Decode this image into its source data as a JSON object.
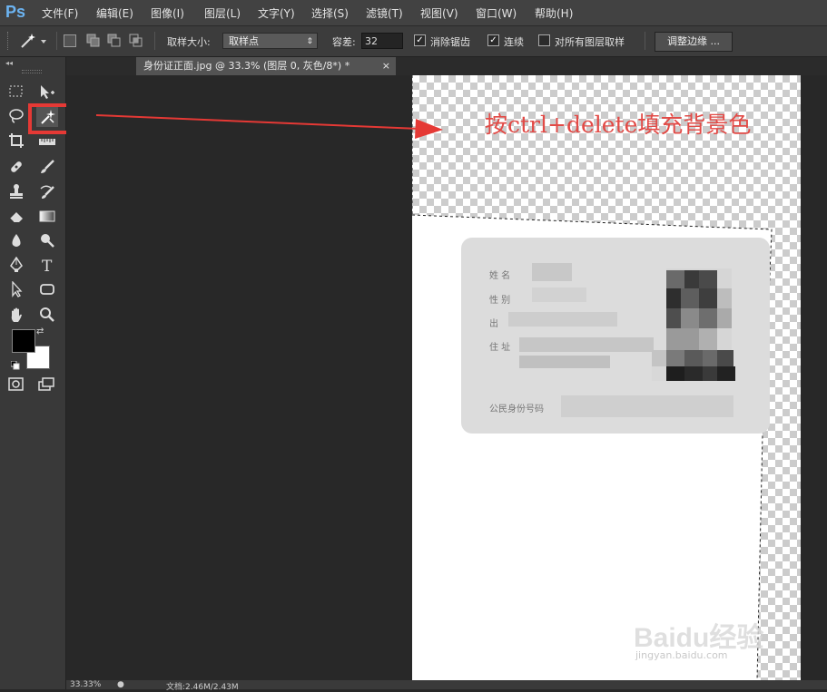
{
  "app": {
    "logo": "Ps"
  },
  "menu": [
    "文件(F)",
    "编辑(E)",
    "图像(I)",
    "图层(L)",
    "文字(Y)",
    "选择(S)",
    "滤镜(T)",
    "视图(V)",
    "窗口(W)",
    "帮助(H)"
  ],
  "options": {
    "sample_size_label": "取样大小:",
    "sample_size_value": "取样点",
    "tolerance_label": "容差:",
    "tolerance_value": "32",
    "antialias_label": "消除锯齿",
    "antialias_checked": true,
    "contiguous_label": "连续",
    "contiguous_checked": true,
    "sample_all_label": "对所有图层取样",
    "sample_all_checked": false,
    "refine_edge_label": "调整边缘 ..."
  },
  "document": {
    "tab_title": "身份证正面.jpg @ 33.3% (图层 0, 灰色/8*) *",
    "close_glyph": "×"
  },
  "card": {
    "name_label": "姓 名",
    "sex_label": "性 别",
    "birth_label": "出",
    "address_label": "住 址",
    "id_label": "公民身份号码"
  },
  "annotation": {
    "text": "按ctrl+delete填充背景色",
    "color": "#e24a46"
  },
  "status": {
    "zoom": "33.33%",
    "doc_info": "文档:2.46M/2.43M"
  },
  "watermark": {
    "brand": "Baidu经验",
    "url": "jingyan.baidu.com"
  },
  "colors": {
    "foreground": "#000000",
    "background": "#ffffff",
    "highlight": "#e53935"
  }
}
